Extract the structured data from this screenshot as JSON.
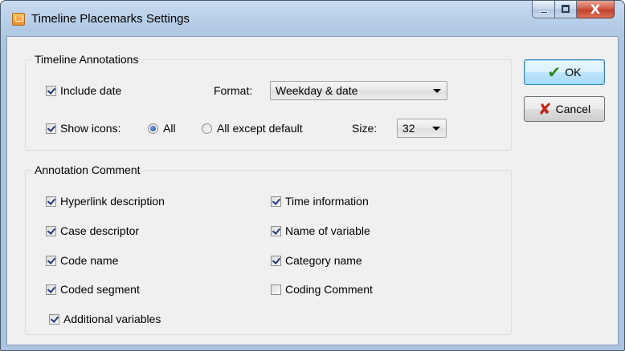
{
  "window": {
    "title": "Timeline Placemarks Settings",
    "close_glyph": "X"
  },
  "annotations": {
    "group_title": "Timeline Annotations",
    "include_date": {
      "label": "Include date",
      "checked": true
    },
    "format": {
      "label": "Format:",
      "value": "Weekday & date"
    },
    "show_icons": {
      "label": "Show icons:",
      "checked": true
    },
    "radio_all": {
      "label": "All",
      "selected": true
    },
    "radio_except": {
      "label": "All except default",
      "selected": false
    },
    "size": {
      "label": "Size:",
      "value": "32"
    }
  },
  "comment": {
    "group_title": "Annotation Comment",
    "left": [
      {
        "label": "Hyperlink description",
        "checked": true
      },
      {
        "label": "Case descriptor",
        "checked": true
      },
      {
        "label": "Code name",
        "checked": true
      },
      {
        "label": "Coded segment",
        "checked": true
      },
      {
        "label": "Additional variables",
        "checked": true
      }
    ],
    "right": [
      {
        "label": "Time information",
        "checked": true
      },
      {
        "label": "Name of variable",
        "checked": true
      },
      {
        "label": "Category name",
        "checked": true
      },
      {
        "label": "Coding Comment",
        "checked": false
      }
    ]
  },
  "buttons": {
    "ok": {
      "label": "OK",
      "icon": "checkmark-icon"
    },
    "cancel": {
      "label": "Cancel",
      "icon": "x-icon"
    }
  },
  "colors": {
    "titlebar": "#b4cce6",
    "ok_icon": "#2f8a1a",
    "cancel_icon": "#c0281c",
    "close_button": "#c2402a"
  }
}
